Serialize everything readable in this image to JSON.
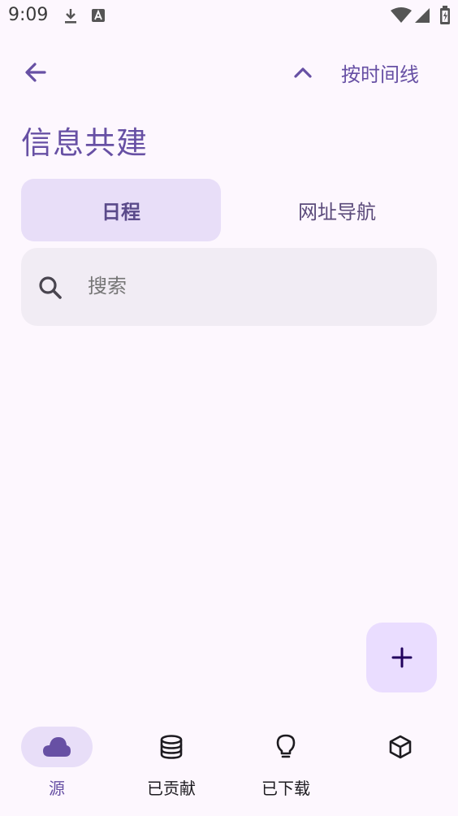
{
  "status_bar": {
    "time": "9:09"
  },
  "app_bar": {
    "timeline_label": "按时间线"
  },
  "page": {
    "title": "信息共建"
  },
  "tabs": [
    {
      "label": "日程",
      "active": true
    },
    {
      "label": "网址导航",
      "active": false
    }
  ],
  "search": {
    "placeholder": "搜索",
    "value": ""
  },
  "bottom_nav": {
    "items": [
      {
        "label": "源",
        "icon": "cloud-icon",
        "active": true
      },
      {
        "label": "已贡献",
        "icon": "database-icon",
        "active": false
      },
      {
        "label": "已下载",
        "icon": "lightbulb-icon",
        "active": false
      },
      {
        "label": "",
        "icon": "package-icon",
        "active": false
      }
    ]
  },
  "colors": {
    "background": "#FDF7FE",
    "accent": "#6750A4",
    "tab_active": "#E8DEF8",
    "fab": "#EADDFF",
    "search_bg": "#F1ECF4"
  }
}
